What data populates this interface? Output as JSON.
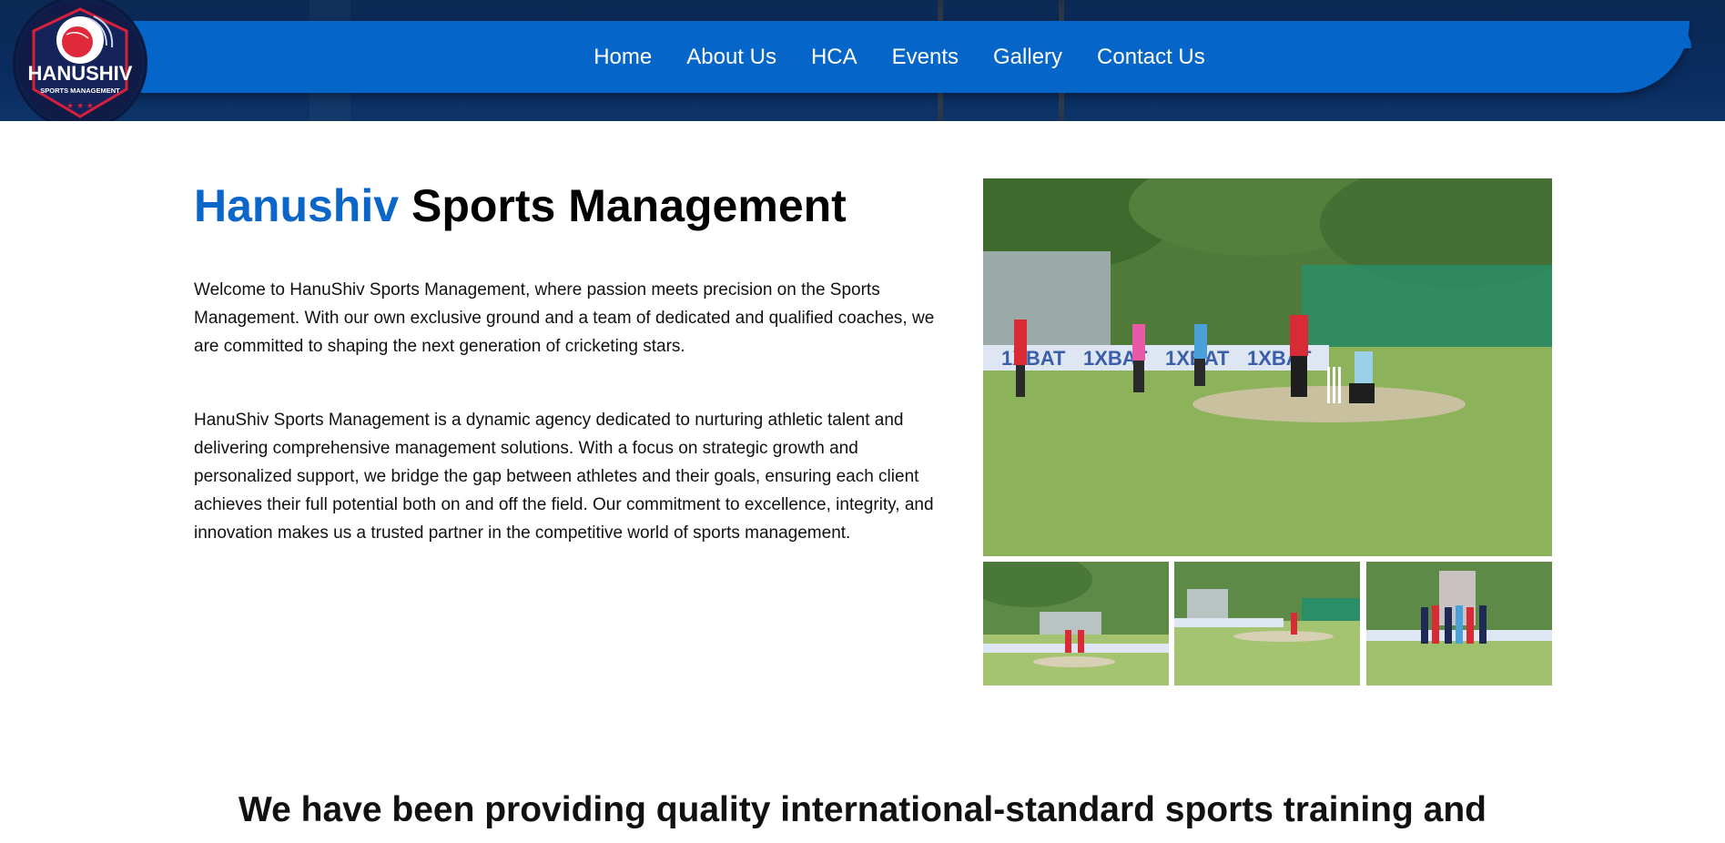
{
  "brand": {
    "logo_name": "HANUSHIV",
    "logo_subtitle": "SPORTS MANAGEMENT"
  },
  "nav": {
    "items": [
      {
        "label": "Home"
      },
      {
        "label": "About Us"
      },
      {
        "label": "HCA"
      },
      {
        "label": "Events"
      },
      {
        "label": "Gallery"
      },
      {
        "label": "Contact Us"
      }
    ]
  },
  "main": {
    "title_accent": "Hanushiv",
    "title_rest": "Sports Management",
    "paragraph_1": "Welcome to HanuShiv Sports Management, where passion meets precision on the Sports Management. With our own exclusive ground and a team of dedicated and qualified coaches, we are committed to shaping the next generation of cricketing stars.",
    "paragraph_2": "HanuShiv Sports Management is a dynamic agency dedicated to nurturing athletic talent and delivering comprehensive management solutions. With a focus on strategic growth and personalized support, we bridge the gap between athletes and their goals, ensuring each client achieves their full potential both on and off the field. Our commitment to excellence, integrity, and innovation makes us a trusted partner in the competitive world of sports management."
  },
  "tagline": "We have been providing quality international-standard sports training and",
  "gallery": {
    "banner_text": "1XBAT"
  },
  "colors": {
    "accent": "#0a66c8",
    "nav_bg": "#0665c8",
    "header_bg": "#0b2a55",
    "grass": "#8db35a"
  }
}
